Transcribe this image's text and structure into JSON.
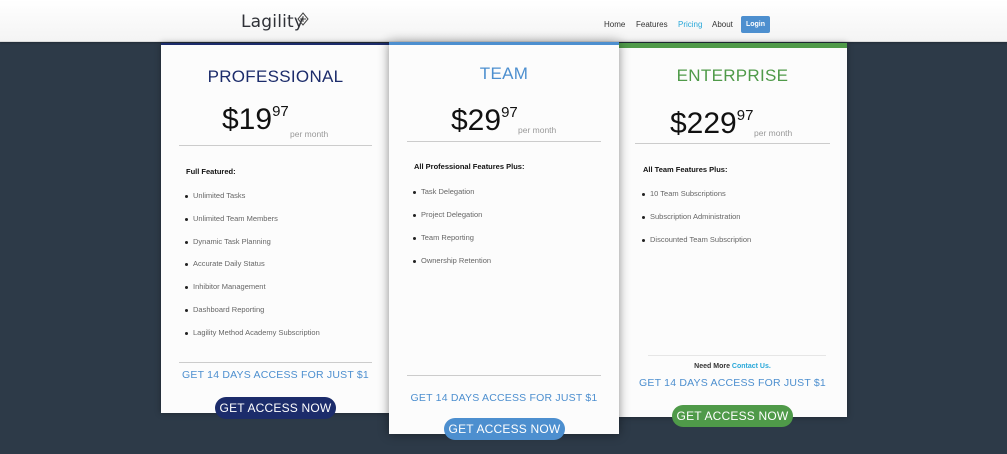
{
  "header": {
    "logo_text": "Lagility",
    "nav": {
      "home": "Home",
      "features": "Features",
      "pricing": "Pricing",
      "about": "About",
      "login": "Login"
    }
  },
  "plans": [
    {
      "title": "PROFESSIONAL",
      "price_main": "$19",
      "price_cents": "97",
      "period": "per month",
      "features_heading": "Full Featured:",
      "features": [
        "Unlimited Tasks",
        "Unlimited Team Members",
        "Dynamic Task Planning",
        "Accurate Daily Status",
        "Inhibitor Management",
        "Dashboard Reporting",
        "Lagility Method Academy Subscription"
      ],
      "trial_text": "GET 14 DAYS ACCESS FOR JUST $1",
      "cta": "GET ACCESS NOW",
      "accent": "#1c2c6b"
    },
    {
      "title": "TEAM",
      "price_main": "$29",
      "price_cents": "97",
      "period": "per month",
      "features_heading": "All Professional Features Plus:",
      "features": [
        "Task Delegation",
        "Project Delegation",
        "Team Reporting",
        "Ownership Retention"
      ],
      "trial_text": "GET 14 DAYS ACCESS FOR JUST $1",
      "cta": "GET ACCESS NOW",
      "accent": "#4d8fcf"
    },
    {
      "title": "ENTERPRISE",
      "price_main": "$229",
      "price_cents": "97",
      "period": "per month",
      "features_heading": "All Team Features Plus:",
      "features": [
        "10 Team Subscriptions",
        "Subscription Administration",
        "Discounted Team Subscription"
      ],
      "contact_prefix": "Need More",
      "contact_link": "Contact Us.",
      "trial_text": "GET 14 DAYS ACCESS FOR JUST $1",
      "cta": "GET ACCESS NOW",
      "accent": "#4f9a49"
    }
  ]
}
